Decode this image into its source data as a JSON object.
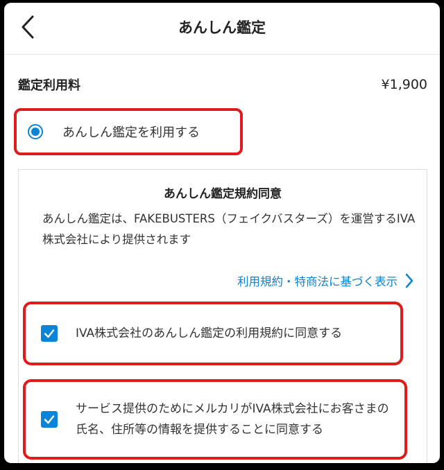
{
  "header": {
    "title": "あんしん鑑定",
    "back_icon": "chevron-left-icon"
  },
  "fee": {
    "label": "鑑定利用料",
    "price": "¥1,900"
  },
  "radio_option": {
    "label": "あんしん鑑定を利用する",
    "selected": true
  },
  "agreement": {
    "title": "あんしん鑑定規約同意",
    "description": "あんしん鑑定は、FAKEBUSTERS（フェイクバスターズ）を運営するIVA株式会社により提供されます",
    "link_label": "利用規約・特商法に基づく表示",
    "checks": [
      {
        "label": "IVA株式会社のあんしん鑑定の利用規約に同意する",
        "checked": true
      },
      {
        "label": "サービス提供のためにメルカリがIVA株式会社にお客さまの氏名、住所等の情報を提供することに同意する",
        "checked": true
      }
    ]
  },
  "colors": {
    "accent": "#0a84d6",
    "highlight": "#e01b1b"
  }
}
